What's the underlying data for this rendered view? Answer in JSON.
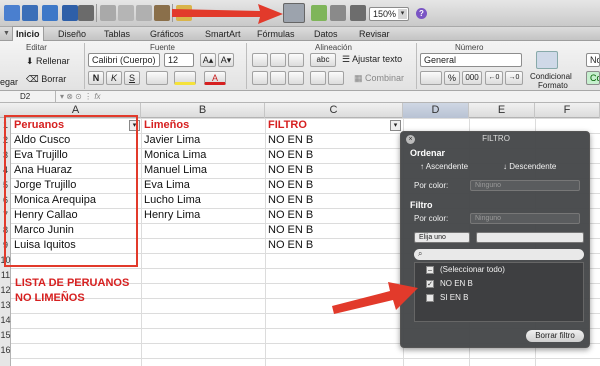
{
  "toolbar": {
    "zoom": "150%",
    "zoom_arrow": "▾"
  },
  "ribbon_tabs": [
    "Inicio",
    "Diseño",
    "Tablas",
    "Gráficos",
    "SmartArt",
    "Fórmulas",
    "Datos",
    "Revisar"
  ],
  "ribbon": {
    "groups": {
      "editar": "Editar",
      "fuente": "Fuente",
      "alineacion": "Alineación",
      "numero": "Número"
    },
    "paste_label": "egar",
    "fill_label": "Rellenar",
    "clear_label": "Borrar",
    "font_name": "Calibri (Cuerpo)",
    "font_size": "12",
    "wrap_text": "Ajustar texto",
    "merge": "Combinar",
    "number_format": "General",
    "cond_format_line1": "Condicional",
    "cond_format_line2": "Formato",
    "style_label": "No",
    "style_label2": "Co",
    "bold": "N",
    "italic": "K",
    "underline": "S",
    "font_grow": "A▴",
    "font_shrink": "A▾",
    "abc": "abc",
    "percent": "%",
    "thousands": "000",
    "dec_inc": "←0",
    "dec_dec": "→0"
  },
  "formula_bar": {
    "name_box": "D2",
    "fx": "fx"
  },
  "columns": [
    "A",
    "B",
    "C",
    "D",
    "E",
    "F"
  ],
  "rows": [
    "1",
    "2",
    "3",
    "4",
    "5",
    "6",
    "7",
    "8",
    "9",
    "10",
    "11",
    "12",
    "13",
    "14",
    "15",
    "16"
  ],
  "table": {
    "headers": {
      "a": "Peruanos",
      "b": "Limeños",
      "c": "FILTRO"
    },
    "col_a": [
      "Aldo Cusco",
      "Eva Trujillo",
      "Ana Huaraz",
      "Jorge Trujillo",
      "Monica Arequipa",
      "Henry Callao",
      "Marco Junin",
      "Luisa Iquitos"
    ],
    "col_b": [
      "Javier Lima",
      "Monica Lima",
      "Manuel Lima",
      "Eva Lima",
      "Lucho Lima",
      "Henry Lima"
    ],
    "col_c": [
      "NO EN B",
      "NO EN B",
      "NO EN B",
      "NO EN B",
      "NO EN B",
      "NO EN B",
      "NO EN B",
      "NO EN B"
    ]
  },
  "note": {
    "line1": "LISTA DE PERUANOS",
    "line2": "NO LIMEÑOS"
  },
  "filter_panel": {
    "title": "FILTRO",
    "ordenar": "Ordenar",
    "asc": "Ascendente",
    "desc": "Descendente",
    "por_color": "Por color:",
    "ninguno": "Ninguno",
    "filtro": "Filtro",
    "elija_uno": "Elija uno",
    "items": [
      {
        "label": "(Seleccionar todo)",
        "checked": "–"
      },
      {
        "label": "NO EN B",
        "checked": "✓"
      },
      {
        "label": "SI EN B",
        "checked": ""
      }
    ],
    "clear_button": "Borrar filtro"
  },
  "colors": {
    "accent_red": "#e23a2b",
    "header_red": "#d62020",
    "panel_bg": "#46484a"
  }
}
